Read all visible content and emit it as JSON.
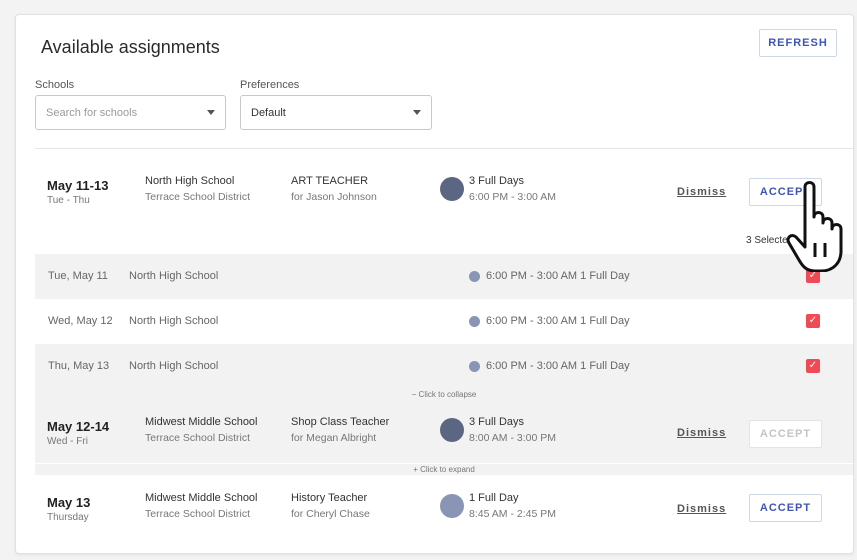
{
  "header": {
    "title": "Available assignments",
    "refresh_label": "REFRESH"
  },
  "filters": {
    "schools_label": "Schools",
    "schools_placeholder": "Search for schools",
    "preferences_label": "Preferences",
    "preferences_value": "Default"
  },
  "assignments": [
    {
      "date": "May 11-13",
      "dow": "Tue - Thu",
      "school": "North High School",
      "district": "Terrace School District",
      "job": "ART TEACHER",
      "for": "for Jason Johnson",
      "days": "3 Full Days",
      "time": "6:00 PM - 3:00 AM",
      "dot_color": "#5b6683",
      "dismiss": "Dismiss",
      "accept": "ACCEPT"
    },
    {
      "date": "May 12-14",
      "dow": "Wed - Fri",
      "school": "Midwest Middle School",
      "district": "Terrace School District",
      "job": "Shop Class Teacher",
      "for": "for Megan Albright",
      "days": "3 Full Days",
      "time": "8:00 AM - 3:00 PM",
      "dot_color": "#5b6683",
      "dismiss": "Dismiss",
      "accept": "ACCEPT"
    },
    {
      "date": "May 13",
      "dow": "Thursday",
      "school": "Midwest Middle School",
      "district": "Terrace School District",
      "job": "History Teacher",
      "for": "for Cheryl Chase",
      "days": "1 Full Day",
      "time": "8:45 AM - 2:45 PM",
      "dot_color": "#8a95b5",
      "dismiss": "Dismiss",
      "accept": "ACCEPT"
    }
  ],
  "selected_count": "3 Selected",
  "details": [
    {
      "date": "Tue, May 11",
      "school": "North High School",
      "time": "6:00 PM - 3:00 AM 1 Full Day",
      "checked": true
    },
    {
      "date": "Wed, May 12",
      "school": "North High School",
      "time": "6:00 PM - 3:00 AM 1 Full Day",
      "checked": true
    },
    {
      "date": "Thu, May 13",
      "school": "North High School",
      "time": "6:00 PM - 3:00 AM 1 Full Day",
      "checked": true
    }
  ],
  "collapse_label": "− Click to collapse",
  "expand_label": "+ Click to expand",
  "checkmark": "✓",
  "colors": {
    "accent": "#3f55b5",
    "checkbox": "#ef4b57",
    "dot_dark": "#5b6683",
    "dot_light": "#8a95b5"
  }
}
